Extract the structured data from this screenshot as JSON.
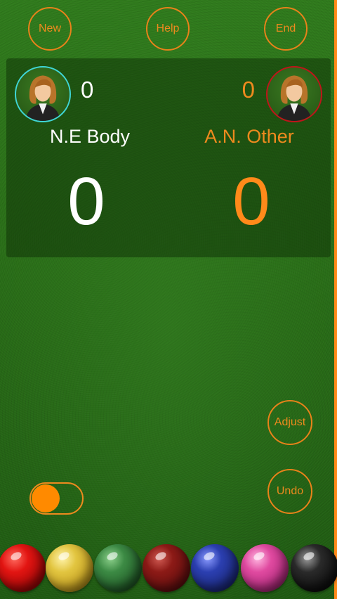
{
  "toolbar": {
    "new_label": "New",
    "help_label": "Help",
    "end_label": "End"
  },
  "players": {
    "left": {
      "name": "N.E Body",
      "break_score": "0",
      "frame_score": "0",
      "color": "#ffffff",
      "ring_color": "#3fd6d6",
      "avatar_icon": "female-avatar-icon"
    },
    "right": {
      "name": "A.N. Other",
      "break_score": "0",
      "frame_score": "0",
      "color": "#ee8a1e",
      "ring_color": "#c0141a",
      "avatar_icon": "female-avatar-icon"
    }
  },
  "controls": {
    "adjust_label": "Adjust",
    "undo_label": "Undo",
    "toggle_on": true
  },
  "balls": [
    {
      "name": "red",
      "color": "#e21512"
    },
    {
      "name": "yellow",
      "color": "#e2c540"
    },
    {
      "name": "green",
      "color": "#3c8a44"
    },
    {
      "name": "brown",
      "color": "#8c1a16"
    },
    {
      "name": "blue",
      "color": "#2b3fb0"
    },
    {
      "name": "pink",
      "color": "#e04aa0"
    },
    {
      "name": "black",
      "color": "#111111"
    }
  ],
  "theme": {
    "accent": "#ee8a1e",
    "felt": "#2a7018"
  }
}
